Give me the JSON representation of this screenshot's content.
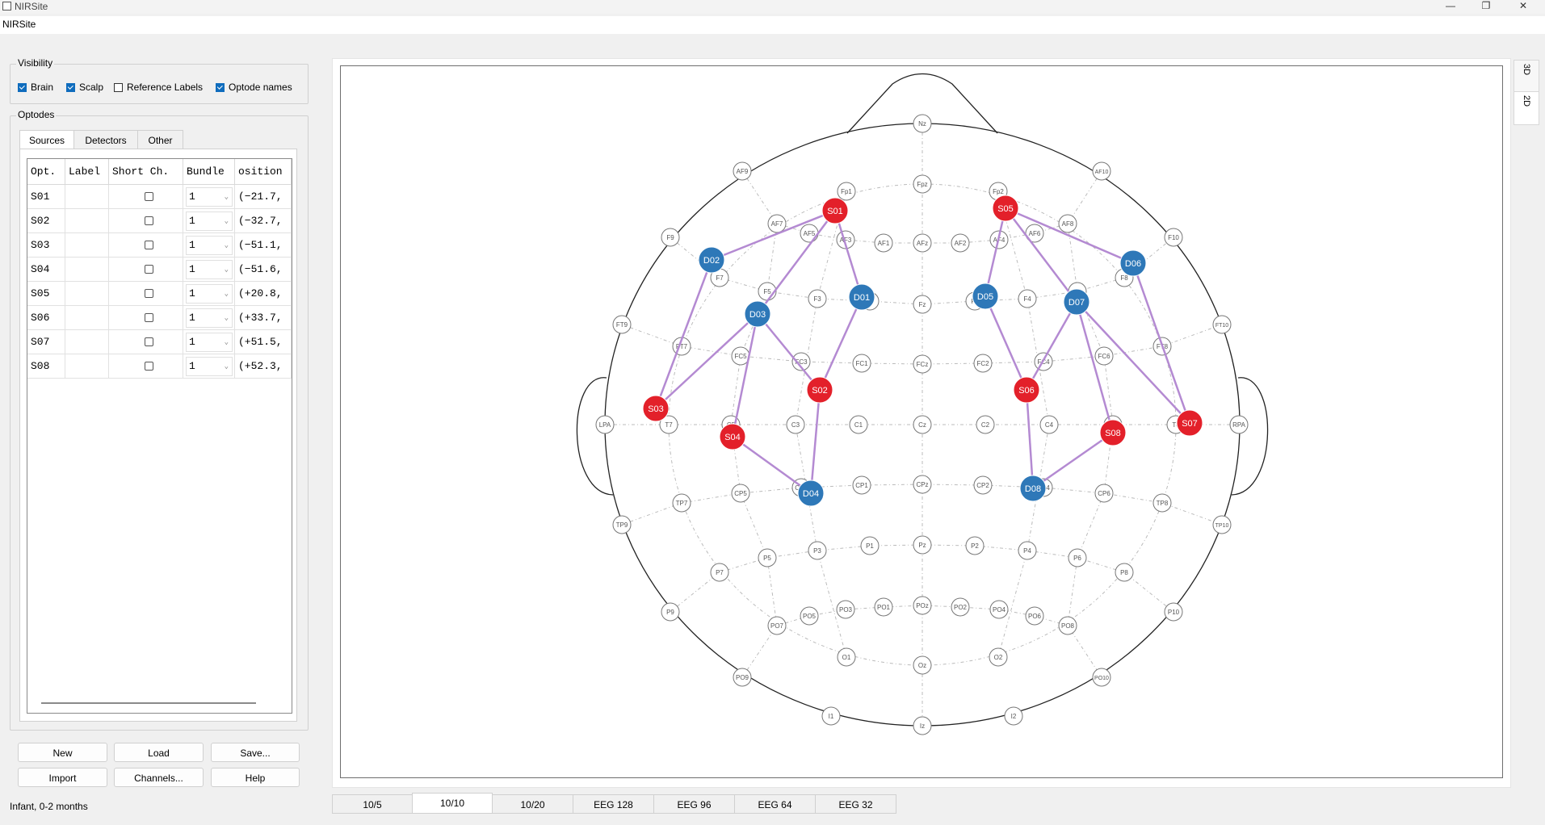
{
  "window": {
    "title": "NIRSite",
    "minimize": "—",
    "restore": "❐",
    "close": "✕"
  },
  "menu": {
    "app": "NIRSite"
  },
  "visibility": {
    "title": "Visibility",
    "brain": {
      "label": "Brain",
      "checked": true
    },
    "scalp": {
      "label": "Scalp",
      "checked": true
    },
    "reference_labels": {
      "label": "Reference Labels",
      "checked": false
    },
    "optode_names": {
      "label": "Optode names",
      "checked": true
    }
  },
  "optodes": {
    "title": "Optodes",
    "tabs": [
      "Sources",
      "Detectors",
      "Other"
    ],
    "active_tab": "Sources",
    "columns": [
      "Opt.",
      "Label",
      "Short Ch.",
      "Bundle",
      "osition"
    ],
    "rows": [
      {
        "opt": "S01",
        "label": "",
        "short": false,
        "bundle": "1",
        "position": "(−21.7,"
      },
      {
        "opt": "S02",
        "label": "",
        "short": false,
        "bundle": "1",
        "position": "(−32.7,"
      },
      {
        "opt": "S03",
        "label": "",
        "short": false,
        "bundle": "1",
        "position": "(−51.1,"
      },
      {
        "opt": "S04",
        "label": "",
        "short": false,
        "bundle": "1",
        "position": "(−51.6,"
      },
      {
        "opt": "S05",
        "label": "",
        "short": false,
        "bundle": "1",
        "position": "(+20.8,"
      },
      {
        "opt": "S06",
        "label": "",
        "short": false,
        "bundle": "1",
        "position": "(+33.7,"
      },
      {
        "opt": "S07",
        "label": "",
        "short": false,
        "bundle": "1",
        "position": "(+51.5,"
      },
      {
        "opt": "S08",
        "label": "",
        "short": false,
        "bundle": "1",
        "position": "(+52.3,"
      }
    ]
  },
  "buttons": {
    "new": "New",
    "load": "Load",
    "save": "Save...",
    "import": "Import",
    "channels": "Channels...",
    "help": "Help"
  },
  "status": "Infant, 0-2 months",
  "view_tabs": [
    "3D",
    "2D"
  ],
  "active_view": "2D",
  "layout_tabs": [
    "10/5",
    "10/10",
    "10/20",
    "EEG 128",
    "EEG 96",
    "EEG 64",
    "EEG 32"
  ],
  "active_layout": "10/10",
  "colors": {
    "source": "#e3202a",
    "detector": "#2e78b8",
    "channel": "#b48ad2"
  },
  "eeg_positions": [
    "Nz",
    "Fpz",
    "Fp1",
    "Fp2",
    "AF9",
    "AF10",
    "AF7",
    "AF5",
    "AF3",
    "AF1",
    "AFz",
    "AF2",
    "AF4",
    "AF6",
    "AF8",
    "F9",
    "F7",
    "F5",
    "F3",
    "F1",
    "Fz",
    "F2",
    "F4",
    "F6",
    "F8",
    "F10",
    "FT9",
    "FT7",
    "FC5",
    "FC3",
    "FC1",
    "FCz",
    "FC2",
    "FC4",
    "FC6",
    "FT8",
    "FT10",
    "LPA",
    "T7",
    "C5",
    "C3",
    "C1",
    "Cz",
    "C2",
    "C4",
    "C6",
    "T8",
    "RPA",
    "TP9",
    "TP7",
    "CP5",
    "CP3",
    "CP1",
    "CPz",
    "CP2",
    "CP4",
    "CP6",
    "TP8",
    "TP10",
    "P9",
    "P7",
    "P5",
    "P3",
    "P1",
    "Pz",
    "P2",
    "P4",
    "P6",
    "P8",
    "P10",
    "PO9",
    "PO7",
    "PO5",
    "PO3",
    "PO1",
    "POz",
    "PO2",
    "PO4",
    "PO6",
    "PO8",
    "PO10",
    "O1",
    "Oz",
    "O2",
    "I1",
    "Iz",
    "I2"
  ],
  "sources": [
    "S01",
    "S02",
    "S03",
    "S04",
    "S05",
    "S06",
    "S07",
    "S08"
  ],
  "detectors": [
    "D01",
    "D02",
    "D03",
    "D04",
    "D05",
    "D06",
    "D07",
    "D08"
  ],
  "channels": [
    [
      "S01",
      "D01"
    ],
    [
      "S01",
      "D02"
    ],
    [
      "S01",
      "D03"
    ],
    [
      "S02",
      "D01"
    ],
    [
      "S02",
      "D03"
    ],
    [
      "S02",
      "D04"
    ],
    [
      "S03",
      "D02"
    ],
    [
      "S03",
      "D03"
    ],
    [
      "S04",
      "D03"
    ],
    [
      "S04",
      "D04"
    ],
    [
      "S05",
      "D05"
    ],
    [
      "S05",
      "D06"
    ],
    [
      "S05",
      "D07"
    ],
    [
      "S06",
      "D05"
    ],
    [
      "S06",
      "D07"
    ],
    [
      "S06",
      "D08"
    ],
    [
      "S07",
      "D06"
    ],
    [
      "S07",
      "D07"
    ],
    [
      "S08",
      "D07"
    ],
    [
      "S08",
      "D08"
    ]
  ]
}
